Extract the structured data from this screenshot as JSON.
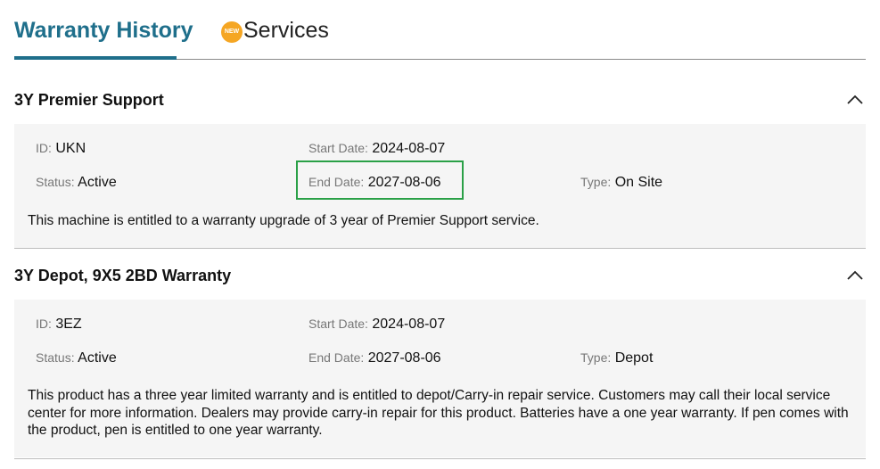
{
  "tabs": {
    "active_label": "Warranty History",
    "services_label": "Services",
    "new_badge": "NEW"
  },
  "warranties": [
    {
      "title": "3Y Premier Support",
      "id_label": "ID",
      "id_value": "UKN",
      "start_label": "Start Date",
      "start_value": "2024-08-07",
      "status_label": "Status",
      "status_value": "Active",
      "end_label": "End Date",
      "end_value": "2027-08-06",
      "type_label": "Type",
      "type_value": "On Site",
      "description": "This machine is entitled to a warranty upgrade of 3 year of Premier Support service."
    },
    {
      "title": "3Y Depot, 9X5 2BD Warranty",
      "id_label": "ID",
      "id_value": "3EZ",
      "start_label": "Start Date",
      "start_value": "2024-08-07",
      "status_label": "Status",
      "status_value": "Active",
      "end_label": "End Date",
      "end_value": "2027-08-06",
      "type_label": "Type",
      "type_value": "Depot",
      "description": "This product has a three year limited warranty and is entitled to depot/Carry-in repair service. Customers may call their local service center for more information. Dealers may provide carry-in repair for this product. Batteries have a one year warranty. If pen comes with the product, pen is entitled to one year warranty."
    }
  ],
  "colors": {
    "accent": "#1f6f8b",
    "highlight": "#2aa047",
    "badge": "#f5a623"
  }
}
